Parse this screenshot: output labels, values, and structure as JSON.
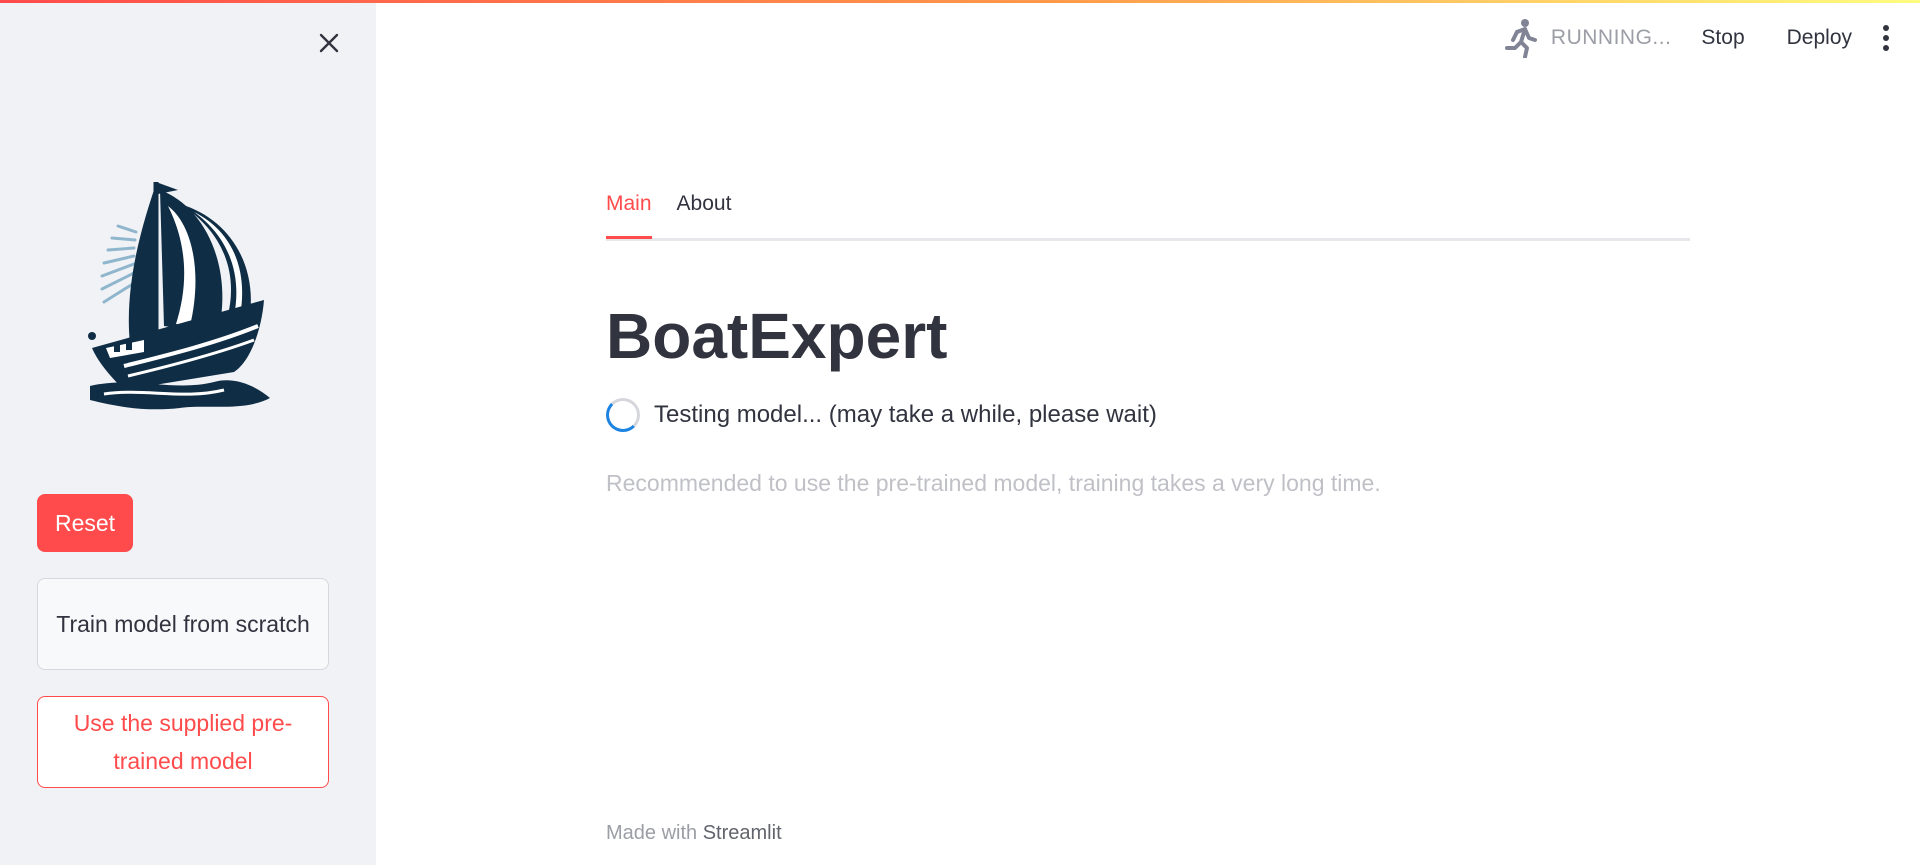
{
  "header": {
    "status": "RUNNING...",
    "stop_label": "Stop",
    "deploy_label": "Deploy"
  },
  "sidebar": {
    "buttons": {
      "reset": "Reset",
      "train": "Train model from scratch",
      "pretrained": "Use the supplied pre-trained model"
    }
  },
  "tabs": [
    {
      "label": "Main",
      "active": true
    },
    {
      "label": "About",
      "active": false
    }
  ],
  "main": {
    "title": "BoatExpert",
    "spinner_text": "Testing model... (may take a while, please wait)",
    "note": "Recommended to use the pre-trained model, training takes a very long time."
  },
  "footer": {
    "prefix": "Made with",
    "brand": "Streamlit"
  },
  "colors": {
    "accent": "#ff4b4b",
    "sidebar_bg": "#f0f2f6",
    "spinner": "#1c83e1",
    "logo": "#0f2d45"
  }
}
